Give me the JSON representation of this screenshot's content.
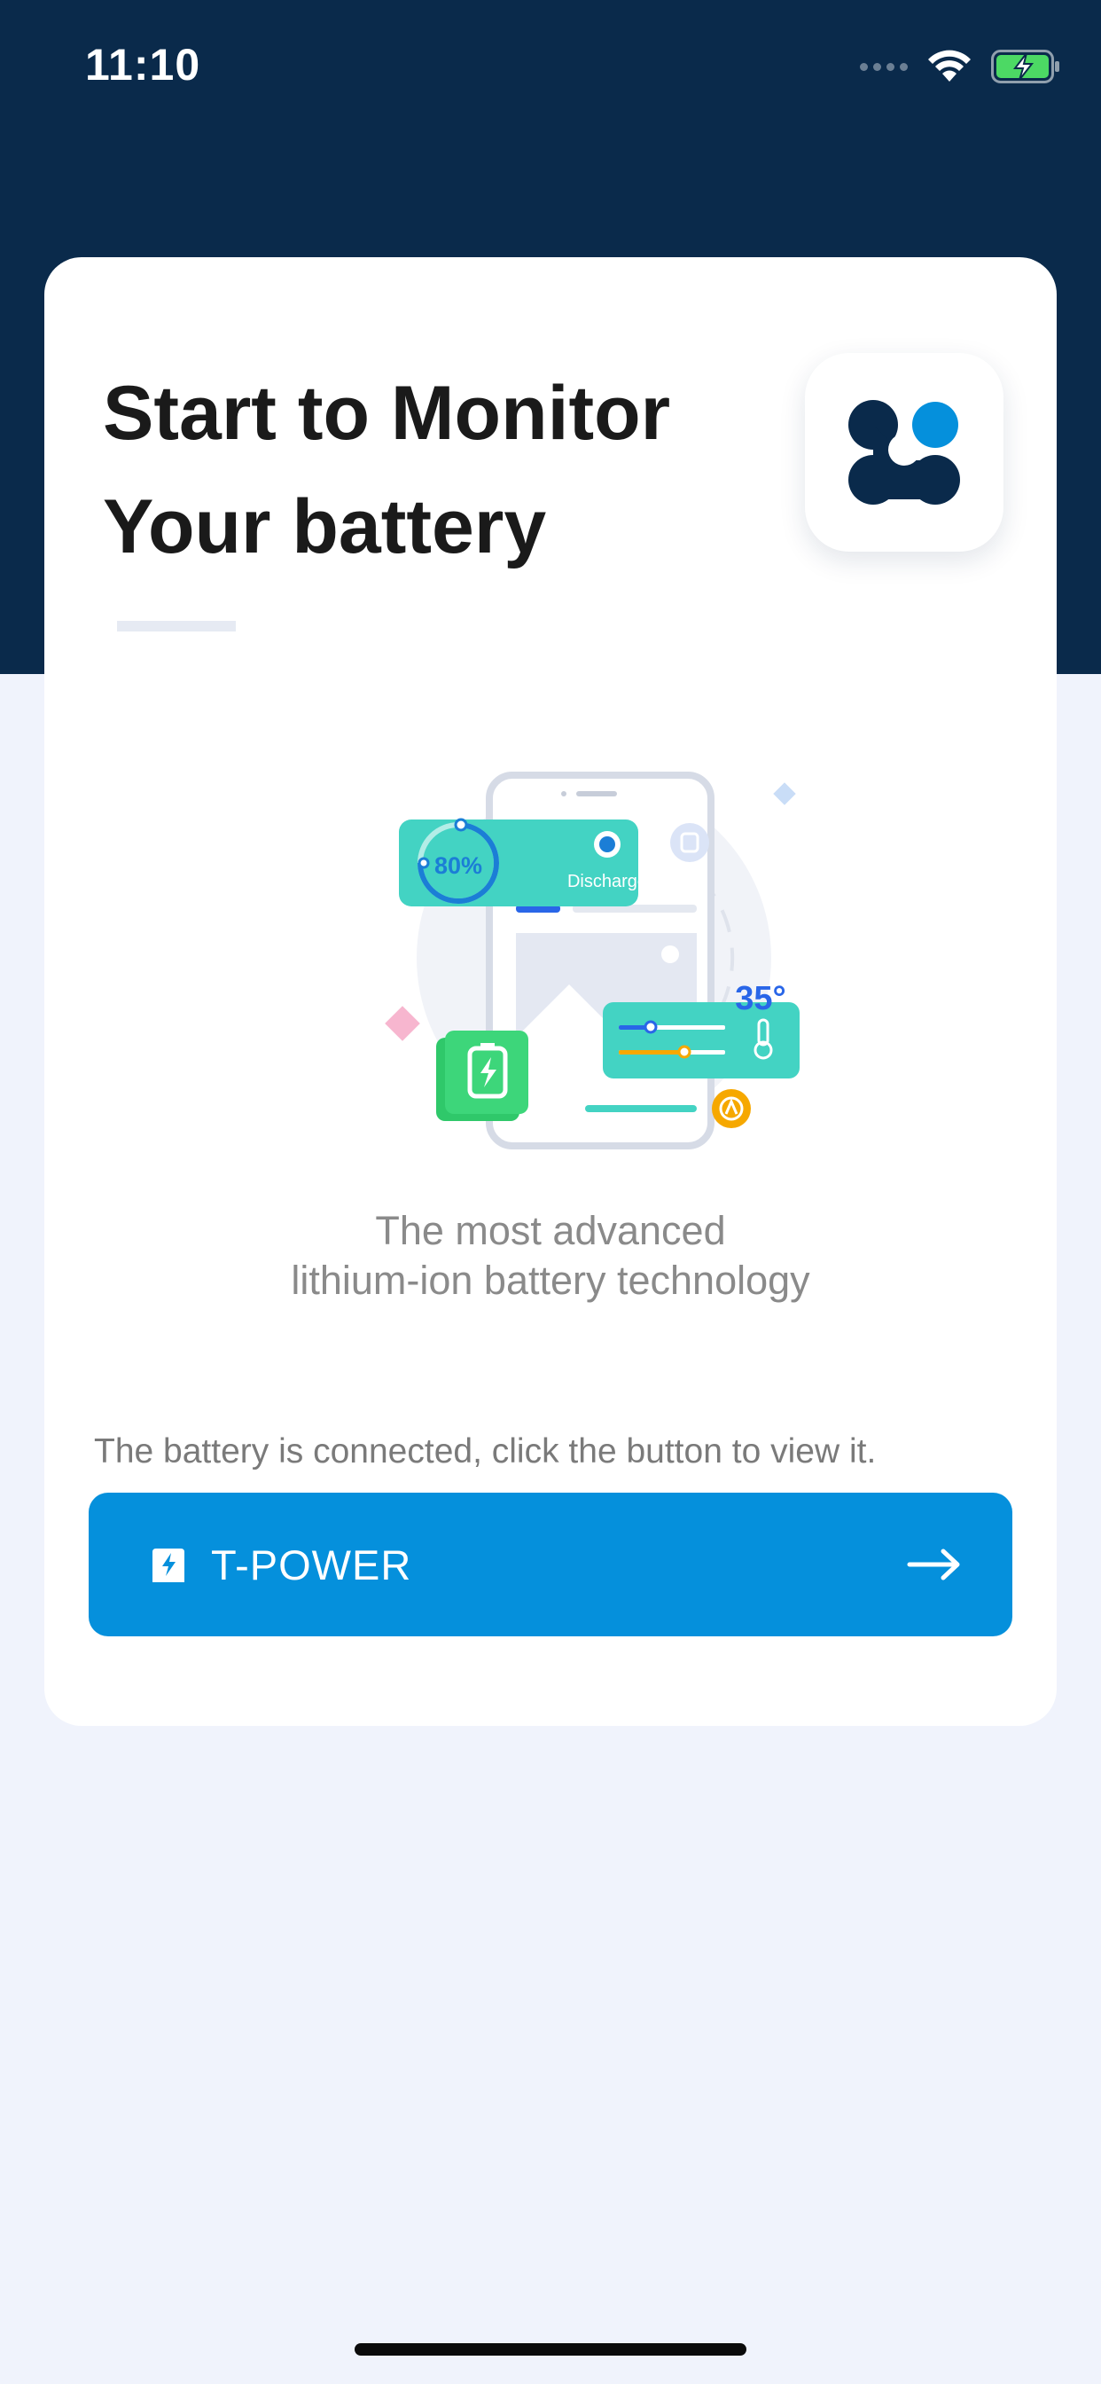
{
  "status_bar": {
    "time": "11:10",
    "icons": [
      "cellular-signal-icon",
      "wifi-icon",
      "battery-charging-icon"
    ]
  },
  "card": {
    "title_line1": "Start to Monitor",
    "title_line2": "Your battery",
    "logo_icon": "app-logo-icon",
    "illustration": {
      "charge_percent_label": "80%",
      "mode_label": "Discharge",
      "temperature_label": "35°"
    },
    "tagline_line1": "The most advanced",
    "tagline_line2": "lithium-ion battery technology",
    "connect_hint": "The battery is connected, click the button to view it.",
    "device_button": {
      "label": "T-POWER",
      "icon": "battery-device-icon",
      "arrow_icon": "arrow-right-icon"
    }
  },
  "colors": {
    "header_bg": "#0a2a4b",
    "page_bg": "#f0f3fc",
    "accent_blue": "#0590dc",
    "teal": "#43d3c3",
    "green": "#3dd67a",
    "orange": "#f6a800",
    "pink": "#f7b6cf"
  }
}
